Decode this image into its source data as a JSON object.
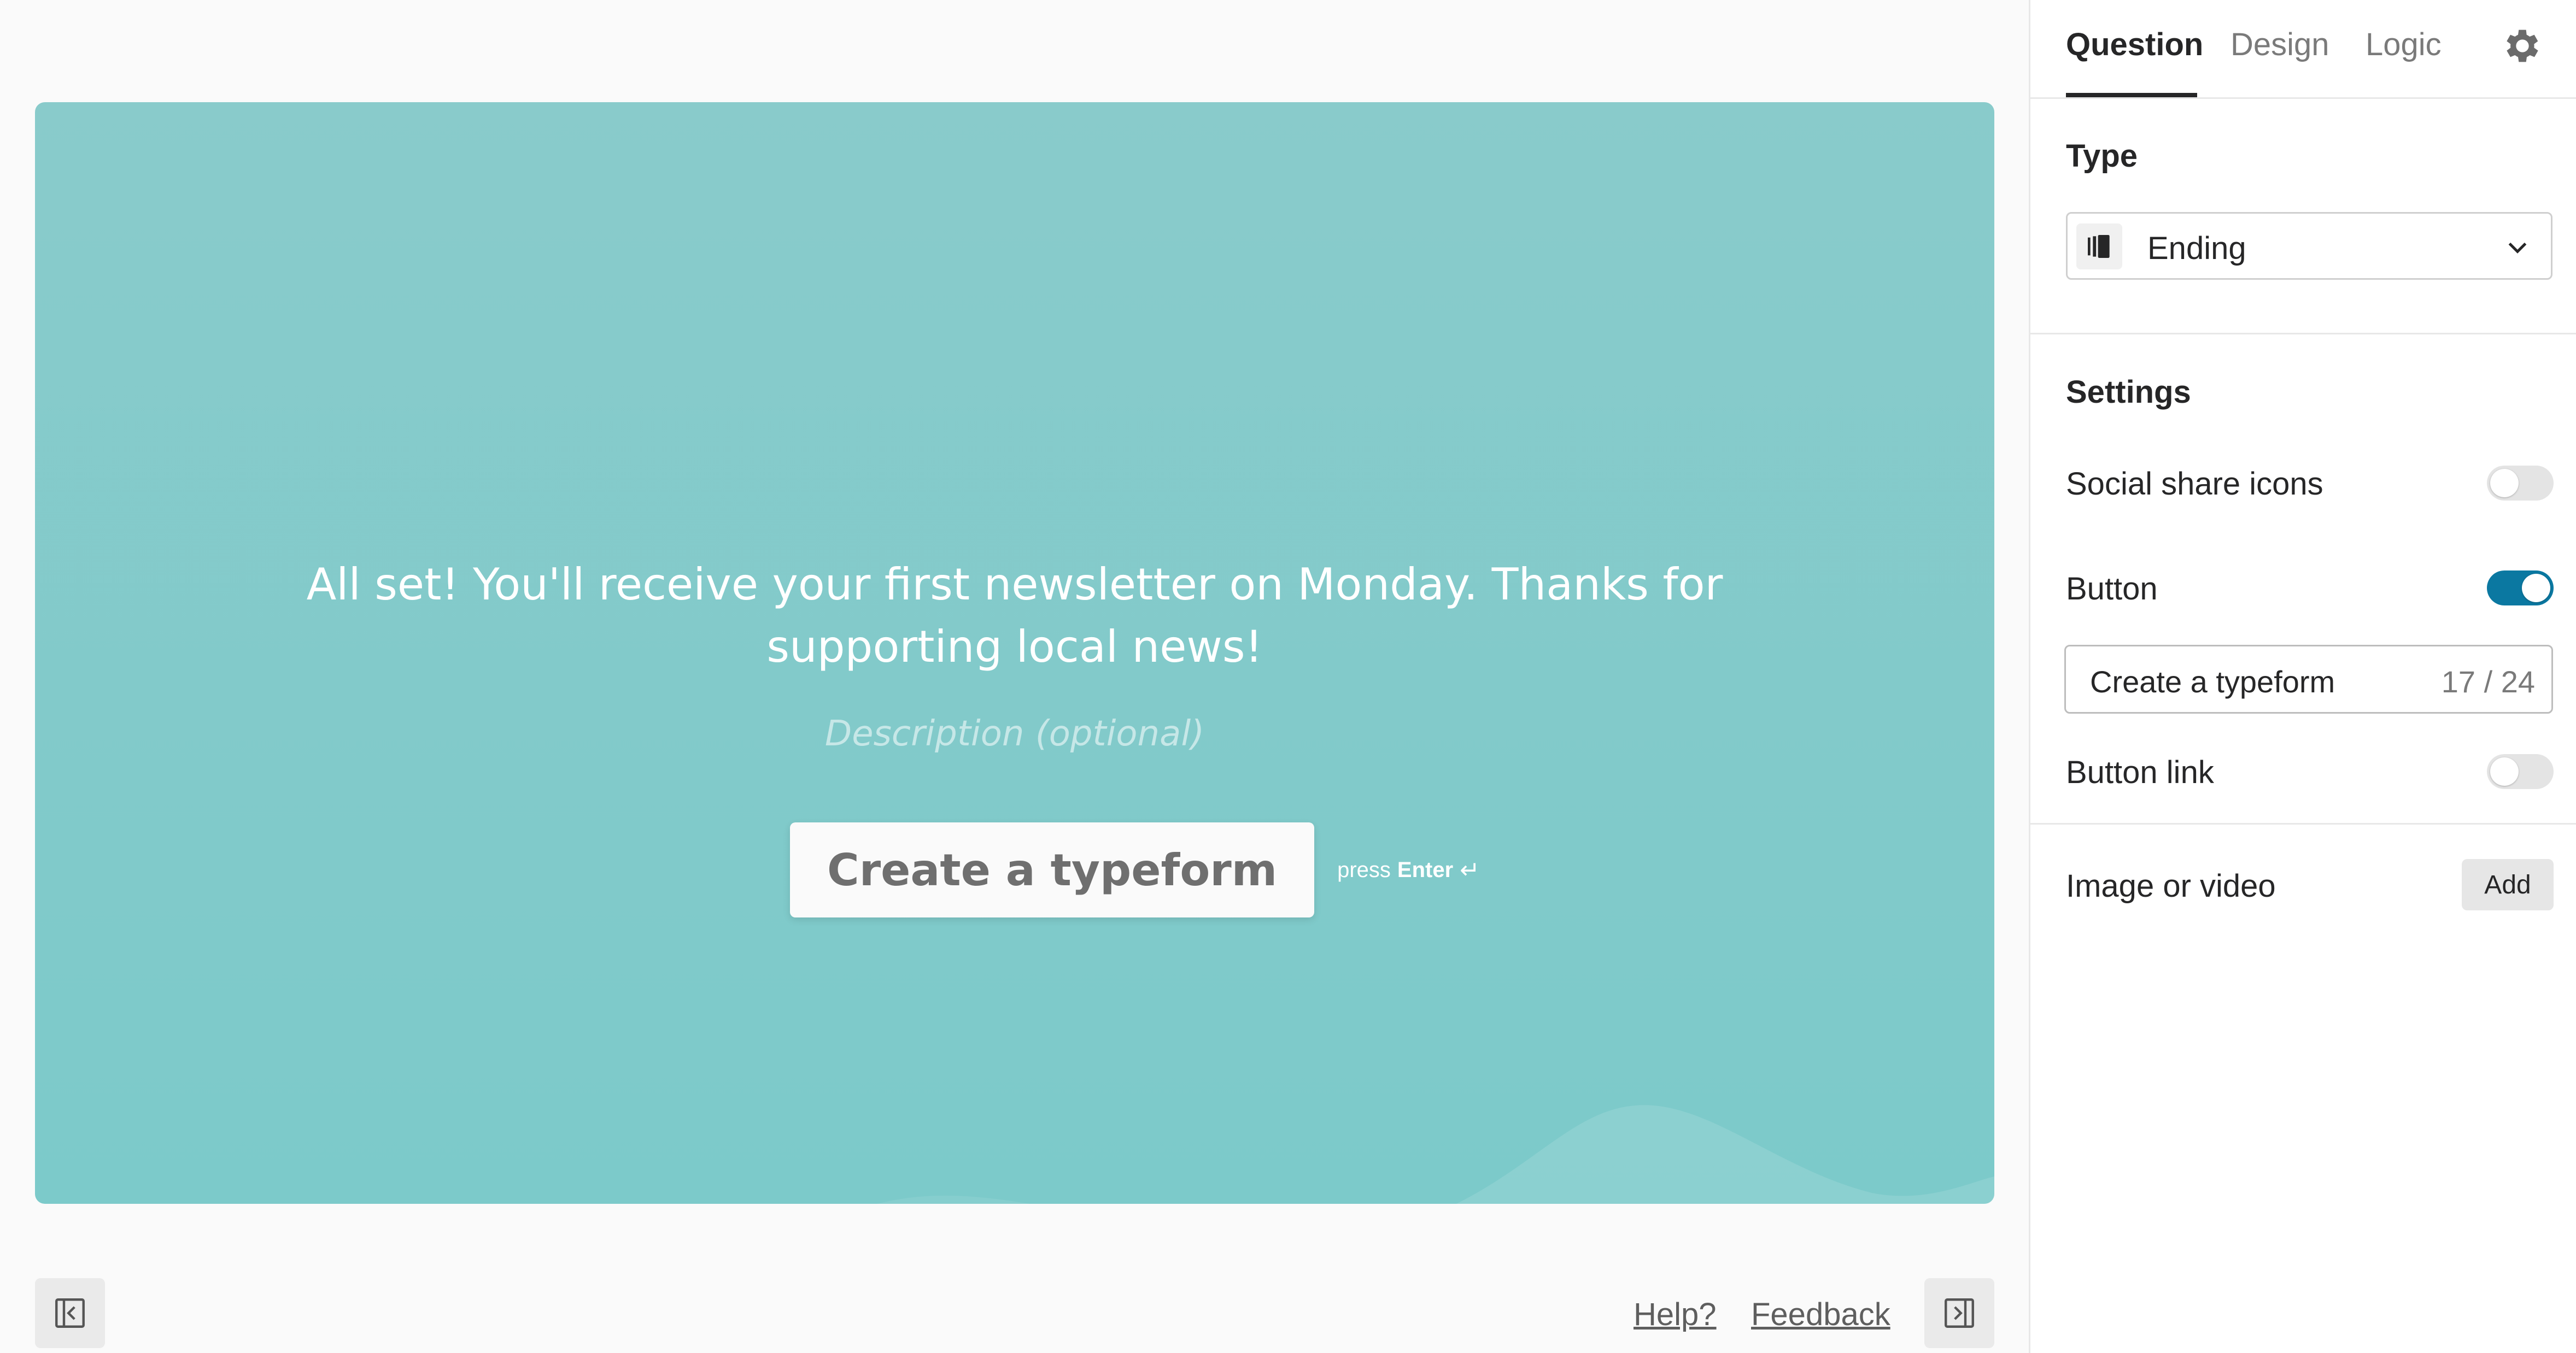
{
  "canvas": {
    "headline_line1": "All set! You'll receive your first newsletter on Monday. Thanks for",
    "headline_line2": "supporting local news!",
    "description_placeholder": "Description (optional)",
    "button_label": "Create a typeform",
    "press_hint_prefix": "press",
    "press_hint_key": "Enter",
    "press_hint_icon": "↵",
    "background_color": "#7ccaca"
  },
  "footer": {
    "help_link": "Help?",
    "feedback_link": "Feedback",
    "left_toggle_icon": "collapse-left-panel-icon",
    "right_toggle_icon": "collapse-right-panel-icon"
  },
  "panel": {
    "tabs": [
      {
        "label": "Question",
        "active": true
      },
      {
        "label": "Design",
        "active": false
      },
      {
        "label": "Logic",
        "active": false
      }
    ],
    "settings_icon": "gear-icon",
    "type_section": {
      "title": "Type",
      "selected": "Ending",
      "icon": "ending-icon"
    },
    "settings_section": {
      "title": "Settings",
      "social_share_icons": {
        "label": "Social share icons",
        "enabled": false
      },
      "button": {
        "label": "Button",
        "enabled": true
      },
      "button_text": {
        "value": "Create a typeform",
        "counter": "17 / 24"
      },
      "button_link": {
        "label": "Button link",
        "enabled": false
      }
    },
    "media_section": {
      "title": "Image or video",
      "add_label": "Add"
    },
    "accent_color": "#0b78a1"
  }
}
